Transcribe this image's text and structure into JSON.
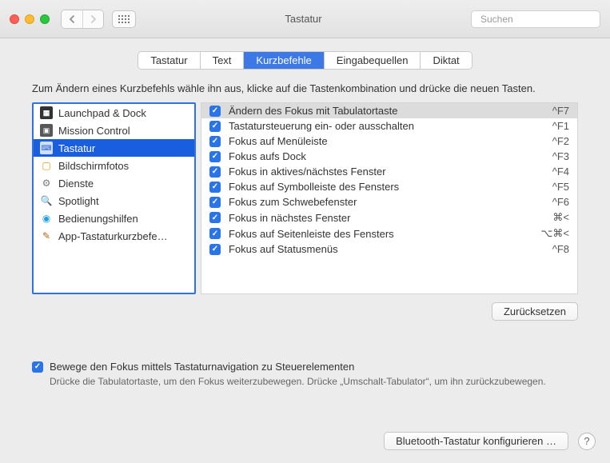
{
  "window": {
    "title": "Tastatur",
    "search_placeholder": "Suchen"
  },
  "tabs": [
    {
      "label": "Tastatur",
      "active": false
    },
    {
      "label": "Text",
      "active": false
    },
    {
      "label": "Kurzbefehle",
      "active": true
    },
    {
      "label": "Eingabequellen",
      "active": false
    },
    {
      "label": "Diktat",
      "active": false
    }
  ],
  "instruction": "Zum Ändern eines Kurzbefehls wähle ihn aus, klicke auf die Tastenkombination und drücke die neuen Tasten.",
  "sidebar": {
    "items": [
      {
        "label": "Launchpad & Dock",
        "icon": "launchpad-icon",
        "selected": false
      },
      {
        "label": "Mission Control",
        "icon": "mission-control-icon",
        "selected": false
      },
      {
        "label": "Tastatur",
        "icon": "keyboard-icon",
        "selected": true
      },
      {
        "label": "Bildschirmfotos",
        "icon": "screenshot-icon",
        "selected": false
      },
      {
        "label": "Dienste",
        "icon": "services-icon",
        "selected": false
      },
      {
        "label": "Spotlight",
        "icon": "spotlight-icon",
        "selected": false
      },
      {
        "label": "Bedienungshilfen",
        "icon": "accessibility-icon",
        "selected": false
      },
      {
        "label": "App-Tastaturkurzbefe…",
        "icon": "app-shortcuts-icon",
        "selected": false
      }
    ]
  },
  "shortcuts": [
    {
      "checked": true,
      "label": "Ändern des Fokus mit Tabulatortaste",
      "keys": "^F7",
      "selected": true
    },
    {
      "checked": true,
      "label": "Tastatursteuerung ein- oder ausschalten",
      "keys": "^F1",
      "selected": false
    },
    {
      "checked": true,
      "label": "Fokus auf Menüleiste",
      "keys": "^F2",
      "selected": false
    },
    {
      "checked": true,
      "label": "Fokus aufs Dock",
      "keys": "^F3",
      "selected": false
    },
    {
      "checked": true,
      "label": "Fokus in aktives/nächstes Fenster",
      "keys": "^F4",
      "selected": false
    },
    {
      "checked": true,
      "label": "Fokus auf Symbolleiste des Fensters",
      "keys": "^F5",
      "selected": false
    },
    {
      "checked": true,
      "label": "Fokus zum Schwebefenster",
      "keys": "^F6",
      "selected": false
    },
    {
      "checked": true,
      "label": "Fokus in nächstes Fenster",
      "keys": "⌘<",
      "selected": false
    },
    {
      "checked": true,
      "label": "Fokus auf Seitenleiste des Fensters",
      "keys": "⌥⌘<",
      "selected": false
    },
    {
      "checked": true,
      "label": "Fokus auf Statusmenüs",
      "keys": "^F8",
      "selected": false
    }
  ],
  "reset_label": "Zurücksetzen",
  "tabnav_option": {
    "checked": true,
    "label": "Bewege den Fokus mittels Tastaturnavigation zu Steuerelementen",
    "hint": "Drücke die Tabulatortaste, um den Fokus weiterzubewegen. Drücke „Umschalt-Tabulator“, um ihn zurückzubewegen."
  },
  "bluetooth_label": "Bluetooth-Tastatur konfigurieren …"
}
